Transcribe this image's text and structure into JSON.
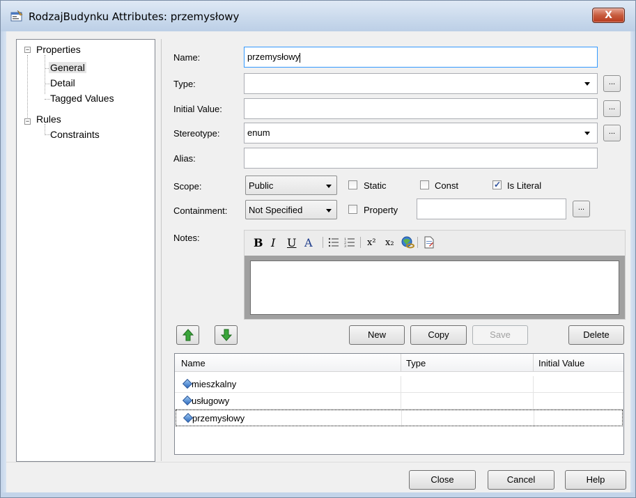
{
  "window": {
    "title": "RodzajBudynku Attributes: przemysłowy",
    "close_glyph": "X"
  },
  "tree": {
    "nodes": [
      {
        "label": "Properties",
        "expander": "−"
      },
      {
        "label": "General"
      },
      {
        "label": "Detail"
      },
      {
        "label": "Tagged Values"
      },
      {
        "label": "Rules",
        "expander": "−"
      },
      {
        "label": "Constraints"
      }
    ]
  },
  "form": {
    "name_label": "Name:",
    "name_value": "przemysłowy",
    "type_label": "Type:",
    "type_value": "",
    "initial_label": "Initial Value:",
    "initial_value": "",
    "stereotype_label": "Stereotype:",
    "stereotype_value": "enum",
    "alias_label": "Alias:",
    "alias_value": "",
    "scope_label": "Scope:",
    "scope_value": "Public",
    "static_label": "Static",
    "static_checked": false,
    "const_label": "Const",
    "const_checked": false,
    "isliteral_label": "Is Literal",
    "isliteral_checked": true,
    "containment_label": "Containment:",
    "containment_value": "Not Specified",
    "property_label": "Property",
    "property_checked": false,
    "property_value": "",
    "notes_label": "Notes:",
    "ellipsis": "..."
  },
  "notes_toolbar": {
    "bold": "B",
    "italic": "I",
    "underline": "U",
    "font_color": "A",
    "superscript": "x²",
    "subscript": "x₂"
  },
  "buttons": {
    "new": "New",
    "copy": "Copy",
    "save": "Save",
    "delete": "Delete",
    "close": "Close",
    "cancel": "Cancel",
    "help": "Help"
  },
  "grid": {
    "columns": [
      "Name",
      "Type",
      "Initial Value"
    ],
    "rows": [
      {
        "name": "mieszkalny",
        "type": "",
        "initial": ""
      },
      {
        "name": "usługowy",
        "type": "",
        "initial": ""
      },
      {
        "name": "przemysłowy",
        "type": "",
        "initial": ""
      }
    ]
  },
  "colors": {
    "up_arrow": "#3aa53a",
    "down_arrow": "#3aa53a",
    "selection_border": "#3399ff"
  }
}
